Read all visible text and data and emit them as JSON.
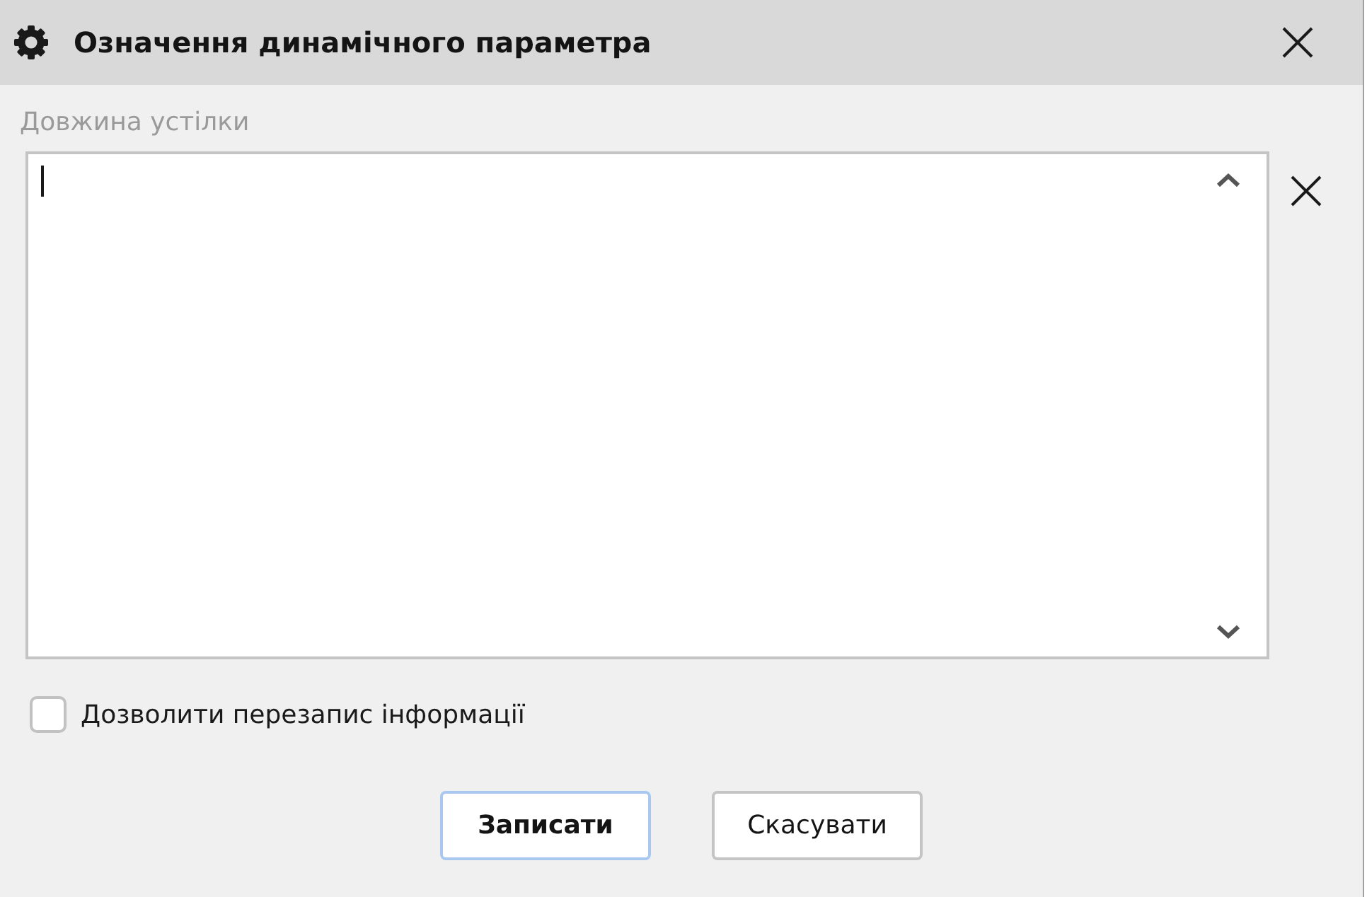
{
  "window": {
    "title": "Означення динамічного параметра"
  },
  "field": {
    "label": "Довжина устілки",
    "focused": true
  },
  "options": [
    {
      "label": "Дозволити перезапис інформації",
      "checked": false
    }
  ],
  "buttons": [
    {
      "label": "Записати",
      "kind": "primary"
    },
    {
      "label": "Скасувати",
      "kind": "secondary"
    }
  ]
}
